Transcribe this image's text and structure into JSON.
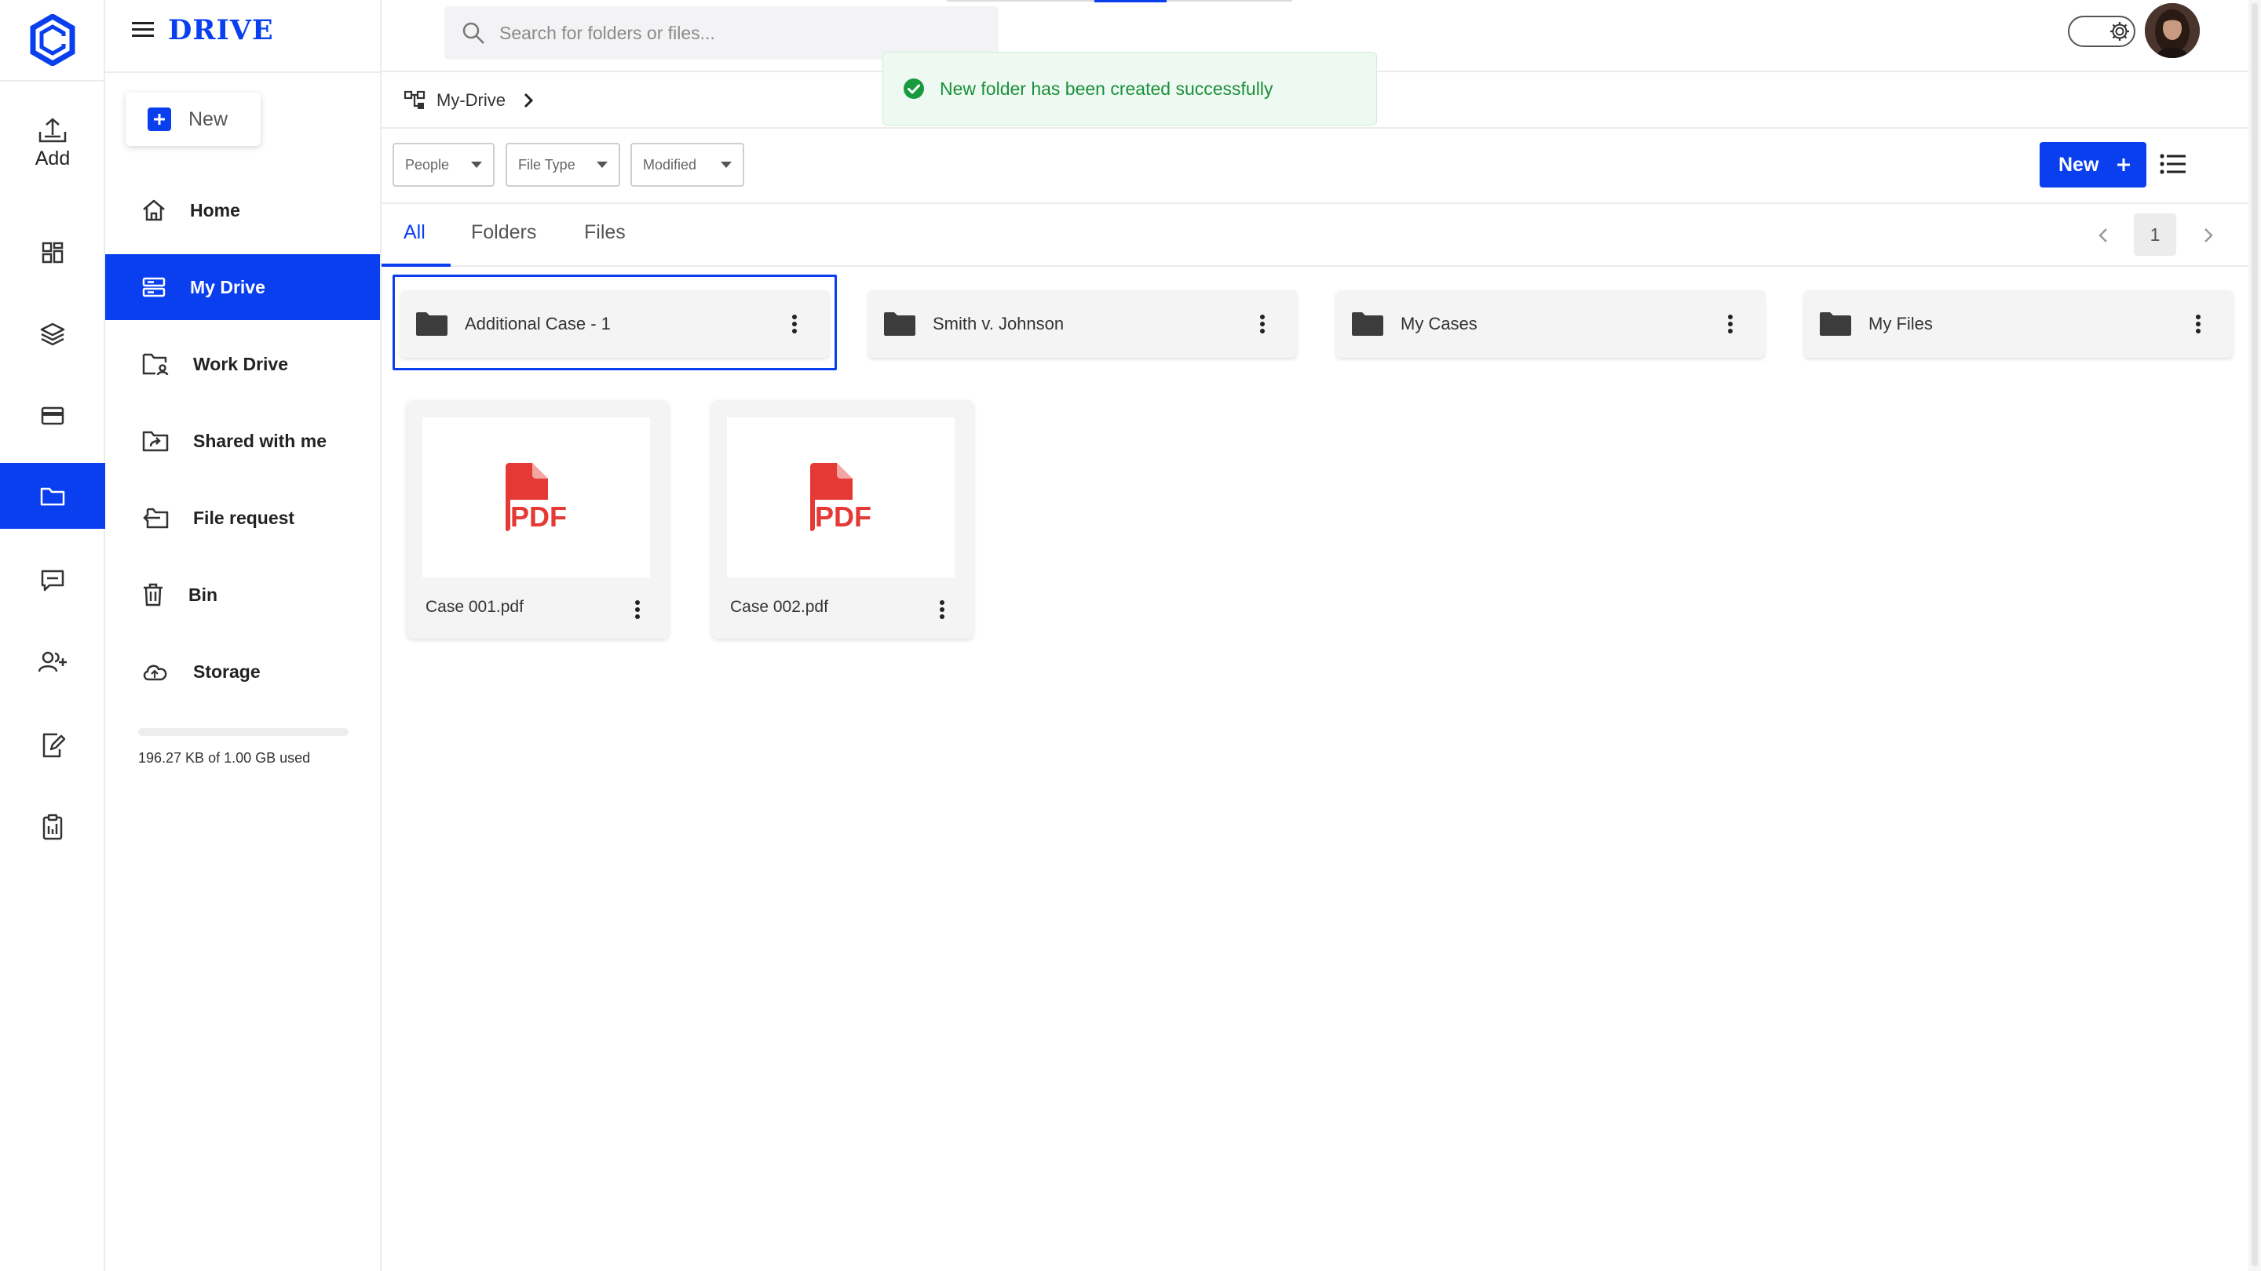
{
  "app": {
    "brand": "DRIVE"
  },
  "rail": {
    "add_label": "Add",
    "icons": [
      "dashboard-icon",
      "layers-icon",
      "card-icon",
      "folder-icon",
      "chat-icon",
      "users-add-icon",
      "edit-document-icon",
      "clipboard-icon"
    ],
    "active_icon": "folder-icon",
    "accent": "#0a3ff0"
  },
  "header": {
    "search_placeholder": "Search for folders or files...",
    "settings_icon": "gear-icon"
  },
  "toast": {
    "message": "New folder has been created successfully",
    "color": "#1a8f3a"
  },
  "sidebar": {
    "new_label": "New",
    "items": [
      {
        "label": "Home",
        "icon": "home-icon"
      },
      {
        "label": "My Drive",
        "icon": "drive-icon",
        "active": true
      },
      {
        "label": "Work Drive",
        "icon": "work-folder-icon"
      },
      {
        "label": "Shared with me",
        "icon": "shared-folder-icon"
      },
      {
        "label": "File request",
        "icon": "file-request-icon"
      },
      {
        "label": "Bin",
        "icon": "trash-icon"
      },
      {
        "label": "Storage",
        "icon": "cloud-icon"
      }
    ],
    "storage": {
      "text": "196.27 KB of 1.00 GB used",
      "used_fraction": 0.0002
    }
  },
  "breadcrumb": {
    "label": "My-Drive"
  },
  "filters": [
    {
      "label": "People"
    },
    {
      "label": "File Type"
    },
    {
      "label": "Modified"
    }
  ],
  "toolbar": {
    "new_label": "New"
  },
  "tabs": [
    {
      "label": "All",
      "active": true
    },
    {
      "label": "Folders"
    },
    {
      "label": "Files"
    }
  ],
  "pagination": {
    "current": "1"
  },
  "folders": [
    {
      "name": "Additional Case - 1",
      "selected": true
    },
    {
      "name": "Smith v. Johnson"
    },
    {
      "name": "My Cases"
    },
    {
      "name": "My Files"
    }
  ],
  "files": [
    {
      "name": "Case 001.pdf",
      "type": "PDF"
    },
    {
      "name": "Case 002.pdf",
      "type": "PDF"
    }
  ]
}
